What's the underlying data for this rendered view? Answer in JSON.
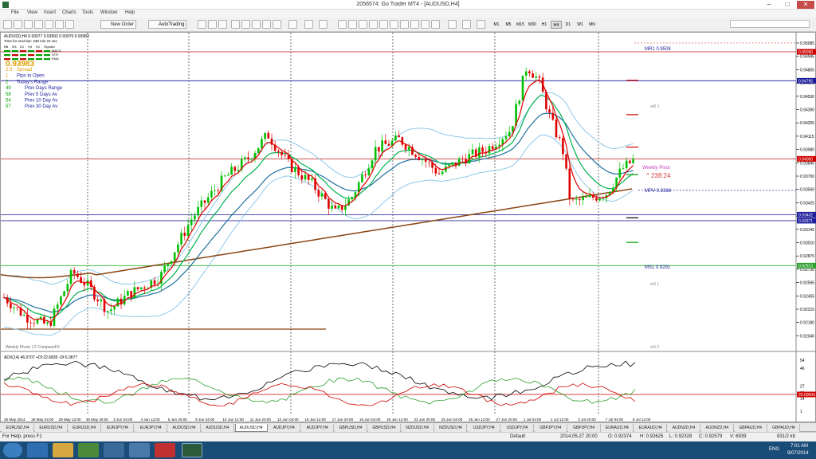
{
  "window": {
    "title": "2056574: Go Trader MT4 - [AUDUSD,H4]"
  },
  "menu": [
    "File",
    "View",
    "Insert",
    "Charts",
    "Tools",
    "Window",
    "Help"
  ],
  "toolbar": {
    "new_order": "New Order",
    "auto_trading": "AutoTrading",
    "timeframes": [
      "M1",
      "M5",
      "M15",
      "M30",
      "H1",
      "H4",
      "D1",
      "W1",
      "MN"
    ],
    "active_timeframe": "H4"
  },
  "chart": {
    "symbol_line": "AUDUSD,H4  0.93977 0.93992 0.93976 0.93983",
    "timer_line": "Time for next bar: 238 min 24 sec",
    "indicator_names": [
      "BB",
      "W1",
      "D1",
      "H4",
      "H1",
      "SignalU",
      "MACD",
      "STR",
      "EMA"
    ],
    "price": "0.93983",
    "info_rows": [
      {
        "value": "2.5",
        "label": "Spread"
      },
      {
        "value": "1",
        "label": "Pips to Open"
      },
      {
        "value": "2",
        "label": "Today's Range"
      },
      {
        "value": "49",
        "label": "Prev Days Range"
      },
      {
        "value": "58",
        "label": "Prev 5 Days Av"
      },
      {
        "value": "54",
        "label": "Prev 10 Day Av"
      },
      {
        "value": "57",
        "label": "Prev 30 Day Av"
      }
    ],
    "pivots": [
      {
        "label": "MR1  0.9508",
        "price": 0.9508
      },
      {
        "label": "MPV  0.9368",
        "price": 0.9368
      },
      {
        "label": "MS1  0.9291",
        "price": 0.9291
      }
    ],
    "weekly_labels": [
      "wR 1",
      "wS 1",
      "wS 2"
    ],
    "weekly_pivot_label": "Weekly Pivot",
    "countdown": "238:24",
    "watermark": "Weekly Pivots | © CompassFX",
    "price_ticks": [
      "0.95085",
      "0.94945",
      "0.94805",
      "0.94670",
      "0.94530",
      "0.94390",
      "0.94255",
      "0.94115",
      "0.93980",
      "0.93840",
      "0.93700",
      "0.93560",
      "0.93425",
      "0.93285",
      "0.93145",
      "0.93010",
      "0.92870",
      "0.92730",
      "0.92595",
      "0.92455",
      "0.92315",
      "0.92180",
      "0.92040"
    ],
    "price_tags": [
      {
        "text": "0.95090",
        "color": "#d00000",
        "price": 0.9509
      },
      {
        "text": "0.94795",
        "color": "#1c1c9c",
        "price": 0.94795
      },
      {
        "text": "0.94000",
        "color": "#d00000",
        "price": 0.94
      },
      {
        "text": "0.93432",
        "color": "#1c1c9c",
        "price": 0.93432
      },
      {
        "text": "0.93371",
        "color": "#1c1c9c",
        "price": 0.93371
      },
      {
        "text": "0.92913",
        "color": "#2ca02c",
        "price": 0.92913
      }
    ],
    "time_labels": [
      "26 May 2014",
      "28 May 04:00",
      "29 May 12:00",
      "30 May 20:00",
      "3 Jun 04:00",
      "4 Jun 12:00",
      "5 Jun 20:00",
      "9 Jun 04:00",
      "10 Jun 12:00",
      "11 Jun 20:00",
      "13 Jun 04:00",
      "16 Jun 12:00",
      "17 Jun 20:00",
      "19 Jun 04:00",
      "20 Jun 12:00",
      "23 Jun 20:00",
      "25 Jun 04:00",
      "26 Jun 12:00",
      "27 Jun 20:00",
      "1 Jul 04:00",
      "2 Jul 12:00",
      "3 Jul 20:00",
      "7 Jul 04:00",
      "8 Jul 12:00"
    ],
    "adx_title": "ADX(14) 46.0707 +DI:22.6835 -DI:6.3877",
    "adx_ticks": [
      "54",
      "46",
      "27",
      "20",
      "14",
      "1"
    ],
    "adx_tag": "20.00000"
  },
  "colors": {
    "bull": "#00c000",
    "bear": "#e00000",
    "ema_fast": "#e00000",
    "ema_mid": "#00b050",
    "ema_slow": "#1f6f9f",
    "bollinger": "#8fc8e8",
    "ma200": "#8b4513"
  },
  "tabs": [
    "EURUSD,H4",
    "EURUSD,H4",
    "EURUSD,H4",
    "EURJPY,H4",
    "EURJPY,H4",
    "AUDUSD,H4",
    "AUDUSD,H4",
    "AUDUSD,H4",
    "AUDJPY,H4",
    "AUDJPY,H4",
    "GBPUSD,H4",
    "GBPUSD,H4",
    "NZDUSD,H4",
    "NZDUSD,H4",
    "USDJPY,H4",
    "USDJPY,H4",
    "GBPJPY,H4",
    "GBPJPY,H4",
    "EURAUD,H4",
    "EURAUD,H4",
    "AUDNZD,H4",
    "AUDNZD,H4",
    "GBPAUD,H4",
    "GBPAUD,H4"
  ],
  "active_tab_index": 7,
  "status": {
    "help": "For Help, press F1",
    "profile": "Default",
    "datetime": "2014.05.27 20:00",
    "open": "O: 0.92374",
    "high": "H: 0.92625",
    "low": "L: 0.92328",
    "close": "C: 0.92579",
    "volume": "V: 6939",
    "traffic": "831/2 kb"
  },
  "tray": {
    "lang": "ENG",
    "time": "7:01 AM",
    "date": "9/07/2014"
  }
}
